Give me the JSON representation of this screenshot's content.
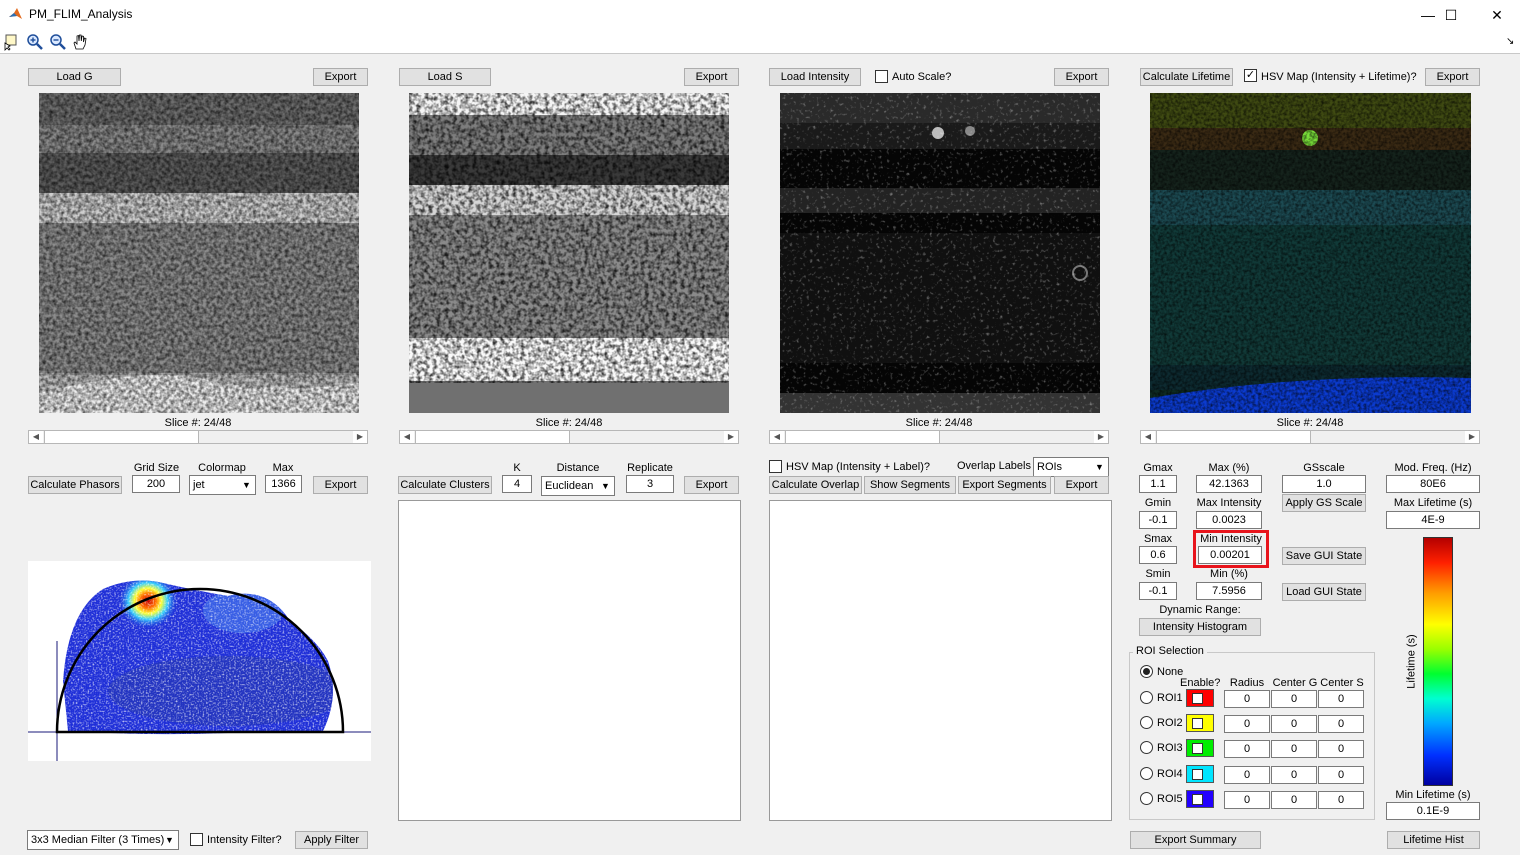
{
  "window": {
    "title": "PM_FLIM_Analysis"
  },
  "titlebar": {
    "minimize": "—",
    "maximize": "☐",
    "close": "✕"
  },
  "toolbar": {
    "arrow_glyph": "↘"
  },
  "panel_g": {
    "load_label": "Load G",
    "export_label": "Export",
    "slice_label": "Slice #: 24/48",
    "slice_value": 0.5
  },
  "panel_s": {
    "load_label": "Load S",
    "export_label": "Export",
    "slice_label": "Slice #: 24/48",
    "slice_value": 0.5
  },
  "panel_int": {
    "load_label": "Load Intensity",
    "autoscale_label": "Auto Scale?",
    "autoscale_checked": false,
    "export_label": "Export",
    "slice_label": "Slice #: 24/48",
    "slice_value": 0.5
  },
  "panel_life": {
    "calc_label": "Calculate Lifetime",
    "hsv_label": "HSV Map (Intensity + Lifetime)?",
    "hsv_checked": true,
    "export_label": "Export",
    "slice_label": "Slice #: 24/48",
    "slice_value": 0.5
  },
  "phasor": {
    "calc_label": "Calculate Phasors",
    "gridsize_label": "Grid Size",
    "gridsize_value": "200",
    "colormap_label": "Colormap",
    "colormap_value": "jet",
    "max_label": "Max",
    "max_value": "1366",
    "export_label": "Export"
  },
  "clusters": {
    "calc_label": "Calculate Clusters",
    "k_label": "K",
    "k_value": "4",
    "distance_label": "Distance",
    "distance_value": "Euclidean",
    "replicate_label": "Replicate",
    "replicate_value": "3",
    "export_label": "Export"
  },
  "overlap": {
    "hsv_label": "HSV Map (Intensity + Label)?",
    "hsv_checked": false,
    "labels_label": "Overlap Labels",
    "labels_value": "ROIs",
    "calc_label": "Calculate Overlap",
    "segments_label": "Show Segments",
    "export_segments_label": "Export Segments",
    "export_label": "Export"
  },
  "params": {
    "gmax_label": "Gmax",
    "gmax_value": "1.1",
    "gmin_label": "Gmin",
    "gmin_value": "-0.1",
    "smax_label": "Smax",
    "smax_value": "0.6",
    "smin_label": "Smin",
    "smin_value": "-0.1",
    "maxpct_label": "Max (%)",
    "maxpct_value": "42.1363",
    "maxint_label": "Max Intensity",
    "maxint_value": "0.0023",
    "minint_label": "Min Intensity",
    "minint_value": "0.00201",
    "minpct_label": "Min (%)",
    "minpct_value": "7.5956",
    "gsscale_label": "GSscale",
    "gsscale_value": "1.0",
    "apply_gs_label": "Apply GS Scale",
    "save_state_label": "Save GUI State",
    "load_state_label": "Load GUI State",
    "dynrange_label": "Dynamic Range:",
    "hist_label": "Intensity Histogram",
    "modfreq_label": "Mod. Freq. (Hz)",
    "modfreq_value": "80E6",
    "maxlife_label": "Max Lifetime (s)",
    "maxlife_value": "4E-9",
    "minlife_label": "Min Lifetime (s)",
    "minlife_value": "0.1E-9",
    "lifetime_axis_label": "Lifetime (s)"
  },
  "roi": {
    "title": "ROI Selection",
    "none_label": "None",
    "enable_label": "Enable?",
    "radius_label": "Radius",
    "centerg_label": "Center G",
    "centers_label": "Center S",
    "rows": [
      {
        "name": "ROI1",
        "color": "#ff0000",
        "radius": "0",
        "center_g": "0",
        "center_s": "0"
      },
      {
        "name": "ROI2",
        "color": "#ffff00",
        "radius": "0",
        "center_g": "0",
        "center_s": "0"
      },
      {
        "name": "ROI3",
        "color": "#00ee00",
        "radius": "0",
        "center_g": "0",
        "center_s": "0"
      },
      {
        "name": "ROI4",
        "color": "#00e5ff",
        "radius": "0",
        "center_g": "0",
        "center_s": "0"
      },
      {
        "name": "ROI5",
        "color": "#2200ff",
        "radius": "0",
        "center_g": "0",
        "center_s": "0"
      }
    ]
  },
  "bottom": {
    "filter_value": "3x3 Median Filter (3 Times)",
    "intensity_filter_label": "Intensity Filter?",
    "apply_filter_label": "Apply Filter",
    "export_summary_label": "Export Summary",
    "lifetime_hist_label": "Lifetime Hist"
  },
  "colors": {
    "highlight": "#e8141c"
  }
}
